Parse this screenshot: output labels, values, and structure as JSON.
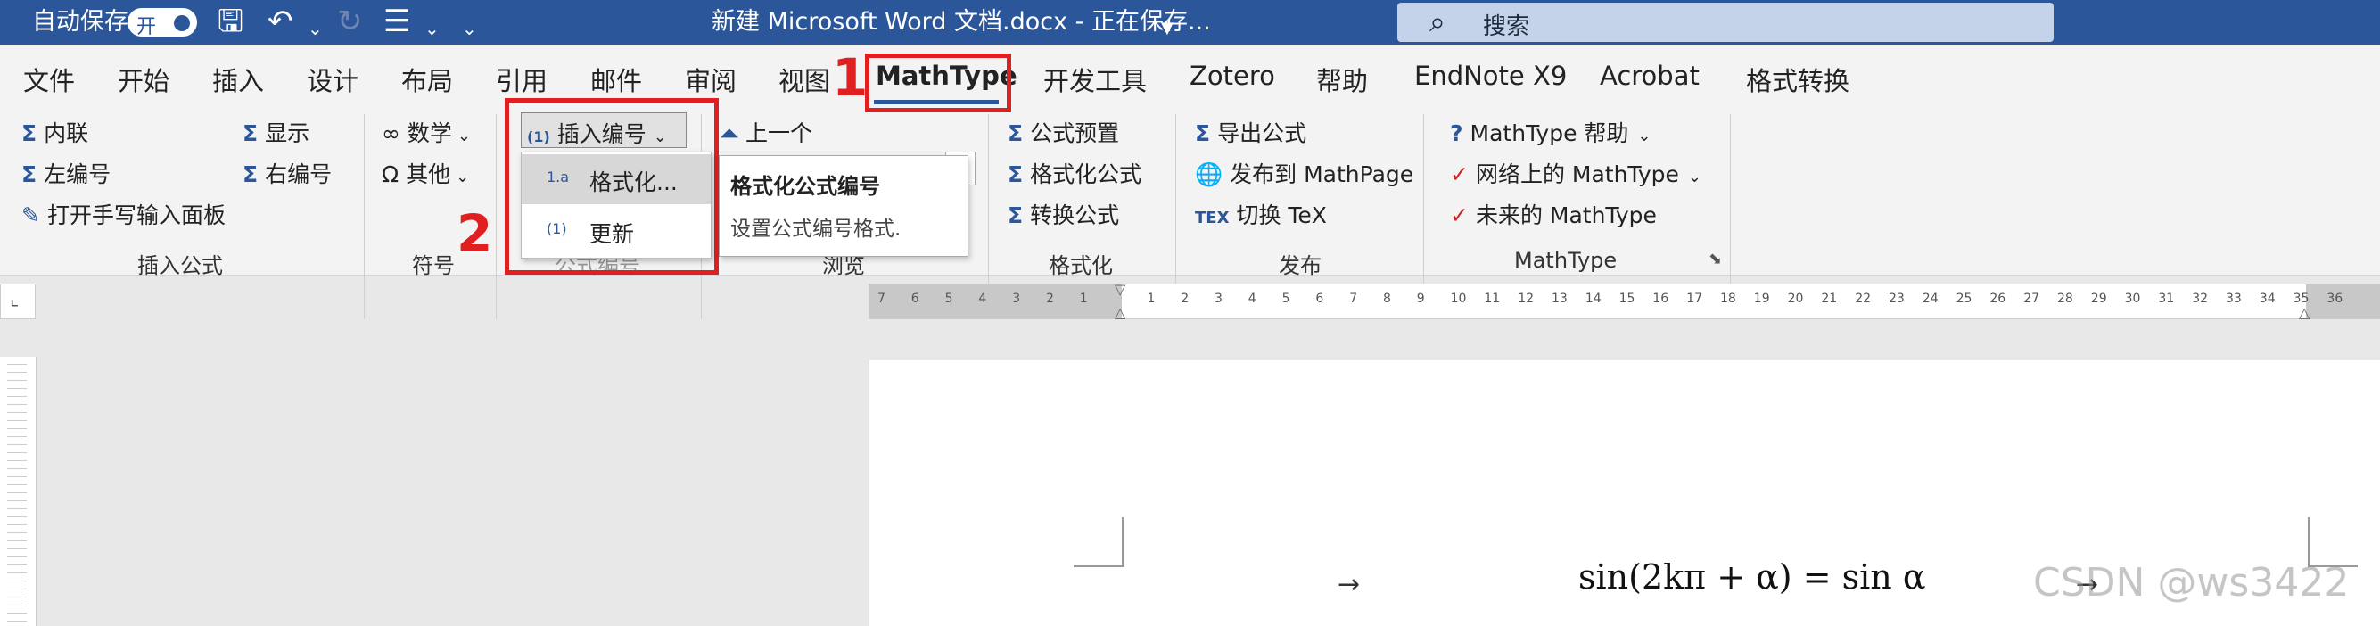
{
  "titlebar": {
    "autosave_label": "自动保存",
    "autosave_state": "开",
    "doc_title": "新建 Microsoft Word 文档.docx  -  正在保存...",
    "search_placeholder": "搜索"
  },
  "tabs": [
    "文件",
    "开始",
    "插入",
    "设计",
    "布局",
    "引用",
    "邮件",
    "审阅",
    "视图",
    "MathType",
    "开发工具",
    "Zotero",
    "帮助",
    "EndNote X9",
    "Acrobat",
    "格式转换"
  ],
  "active_tab": "MathType",
  "groups": {
    "insert_equation": {
      "label": "插入公式",
      "inline": "内联",
      "display": "显示",
      "left_numbered": "左编号",
      "right_numbered": "右编号",
      "handwriting": "打开手写输入面板"
    },
    "symbols": {
      "label": "符号",
      "math": "数学",
      "other": "其他"
    },
    "numbering": {
      "insert_number": "插入编号",
      "label_partial": "公式编号"
    },
    "browse": {
      "label": "浏览",
      "previous": "上一个"
    },
    "format": {
      "label": "格式化",
      "presets": "公式预置",
      "format_equations": "格式化公式",
      "convert": "转换公式"
    },
    "publish": {
      "label": "发布",
      "export": "导出公式",
      "publish_mathpage": "发布到 MathPage",
      "toggle_tex": "切换 TeX"
    },
    "mathtype": {
      "label": "MathType",
      "help": "MathType 帮助",
      "online": "网络上的 MathType",
      "future": "未来的 MathType"
    }
  },
  "dropdown": {
    "items": [
      {
        "icon": "1.a",
        "label": "格式化..."
      },
      {
        "icon": "(1)",
        "label": "更新"
      }
    ]
  },
  "tooltip": {
    "title": "格式化公式编号",
    "desc": "设置公式编号格式."
  },
  "annotations": {
    "step1": "1",
    "step2": "2"
  },
  "ruler_numbers": [
    "7",
    "6",
    "5",
    "4",
    "3",
    "2",
    "1",
    "",
    "1",
    "2",
    "3",
    "4",
    "5",
    "6",
    "7",
    "8",
    "9",
    "10",
    "11",
    "12",
    "13",
    "14",
    "15",
    "16",
    "17",
    "18",
    "19",
    "20",
    "21",
    "22",
    "23",
    "24",
    "25",
    "26",
    "27",
    "28",
    "29",
    "30",
    "31",
    "32",
    "33",
    "34",
    "35",
    "36"
  ],
  "document": {
    "equation": "sin(2kπ + α) = sin α",
    "tab_arrow_left": "→",
    "tab_arrow_right": "→",
    "watermark": "CSDN @ws3422"
  }
}
